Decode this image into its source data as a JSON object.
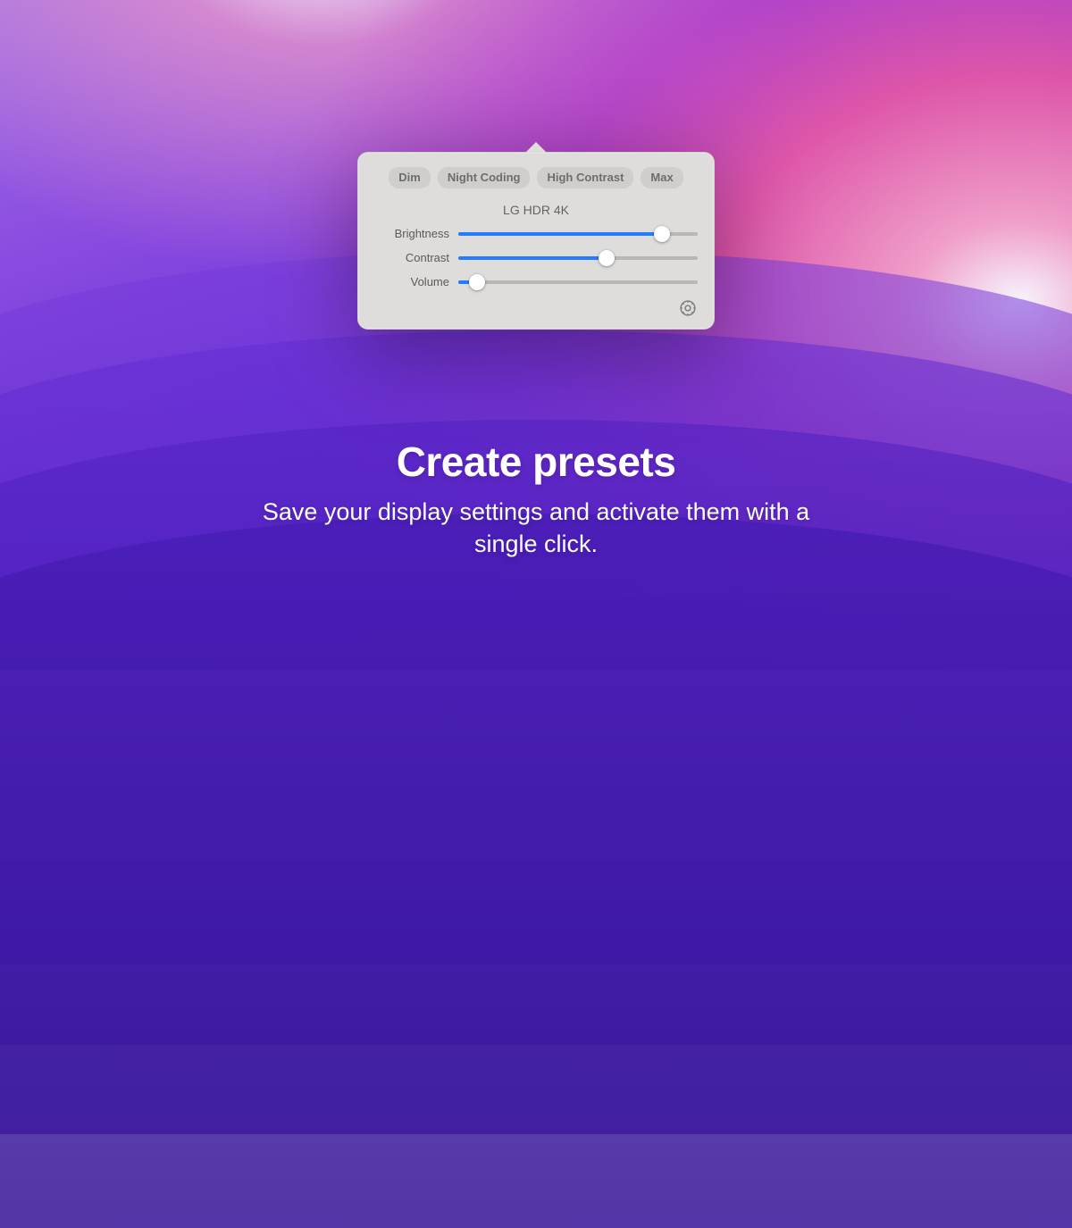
{
  "panel": {
    "presets": [
      "Dim",
      "Night Coding",
      "High Contrast",
      "Max"
    ],
    "device_name": "LG HDR 4K",
    "sliders": [
      {
        "label": "Brightness",
        "value": 85
      },
      {
        "label": "Contrast",
        "value": 62
      },
      {
        "label": "Volume",
        "value": 8
      }
    ],
    "settings_icon": "gear-icon"
  },
  "marketing": {
    "heading": "Create presets",
    "subheading": "Save your display settings and activate them with a single click."
  },
  "colors": {
    "accent": "#247cff"
  }
}
